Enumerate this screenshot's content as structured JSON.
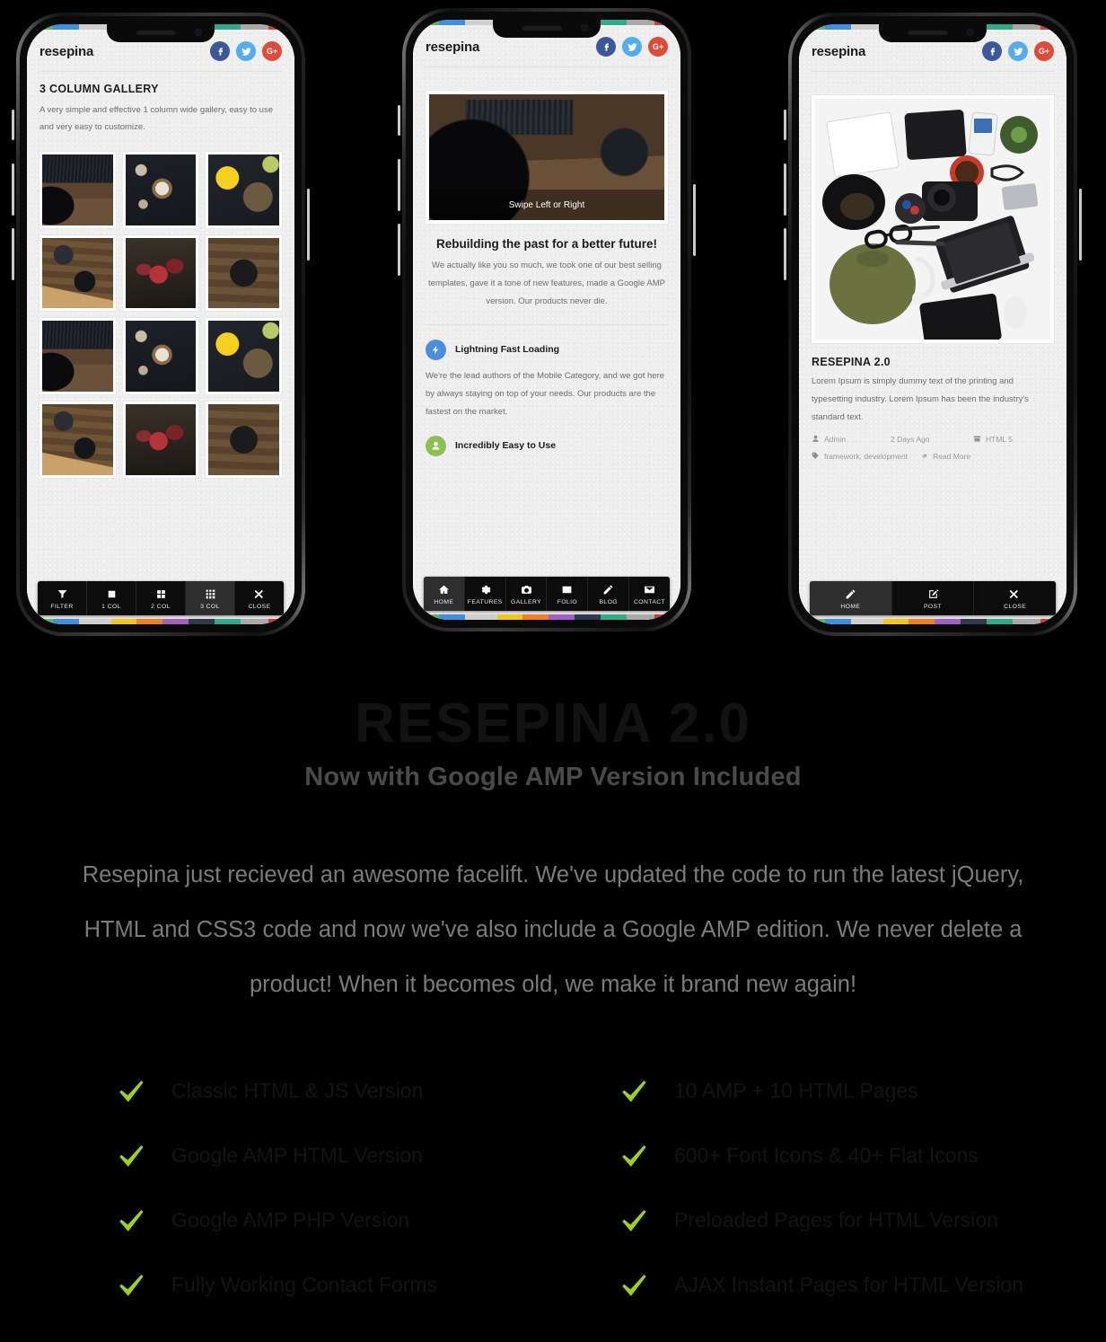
{
  "colors": {
    "facebook": "#3b5998",
    "twitter": "#55acee",
    "googleplus": "#dd4b39",
    "accent_blue": "#4b8ede",
    "accent_green": "#8cc152",
    "check_green": "#9fcf20",
    "nav_active": "#2e2e2e",
    "page_bg": "#000000",
    "screen_bg": "#eeeeee"
  },
  "rainbow": [
    "#5cb85c",
    "#3f8fe0",
    "#cfcfcf",
    "#f5c518",
    "#ef8022",
    "#a45fc4",
    "#2f3b4c",
    "#2fab8a",
    "#a9a9a9",
    "#d9392b"
  ],
  "phone1": {
    "brand": "resepina",
    "socials": [
      {
        "name": "facebook-icon",
        "label": "f"
      },
      {
        "name": "twitter-icon",
        "label": "t"
      },
      {
        "name": "google-plus-icon",
        "label": "G+"
      }
    ],
    "section_title": "3 COLUMN GALLERY",
    "section_desc": "A very simple and effective 1 column wide gallery, easy to use and very easy to customize.",
    "gallery_tiles": [
      "ph-typewriter",
      "ph-bowl",
      "ph-yellow",
      "ph-desk",
      "ph-straw",
      "ph-camera",
      "ph-typewriter",
      "ph-bowl",
      "ph-yellow",
      "ph-desk",
      "ph-straw",
      "ph-camera"
    ],
    "nav": [
      {
        "label": "FILTER",
        "icon": "filter-icon",
        "active": false
      },
      {
        "label": "1 COL",
        "icon": "square-icon",
        "active": false
      },
      {
        "label": "2 COL",
        "icon": "grid-2x2-icon",
        "active": false
      },
      {
        "label": "3 COL",
        "icon": "grid-3x3-icon",
        "active": true
      },
      {
        "label": "CLOSE",
        "icon": "close-icon",
        "active": false
      }
    ]
  },
  "phone2": {
    "brand": "resepina",
    "hero_caption": "Swipe Left or Right",
    "hero_title": "Rebuilding the past for a better future!",
    "hero_text": "We actually like you so much, we took one of our best selling templates, gave it a tone of new features, made a Google AMP version. Our products never die.",
    "features": [
      {
        "title": "Lightning Fast Loading",
        "icon": "bolt-icon",
        "color": "#4b8ede",
        "text": "We're the lead authors of the Mobile Category, and we got here by always staying on top of your needs. Our products are the fastest on the market."
      },
      {
        "title": "Incredibly Easy to Use",
        "icon": "user-icon",
        "color": "#8cc152",
        "text": ""
      }
    ],
    "nav": [
      {
        "label": "HOME",
        "icon": "home-icon",
        "active": true
      },
      {
        "label": "FEATURES",
        "icon": "gear-icon",
        "active": false
      },
      {
        "label": "GALLERY",
        "icon": "camera-icon",
        "active": false
      },
      {
        "label": "FOLIO",
        "icon": "image-icon",
        "active": false
      },
      {
        "label": "BLOG",
        "icon": "pencil-icon",
        "active": false
      },
      {
        "label": "CONTACT",
        "icon": "envelope-icon",
        "active": false
      }
    ]
  },
  "phone3": {
    "brand": "resepina",
    "post_title": "RESEPINA 2.0",
    "post_text": "Lorem Ipsum is simply dummy text of the printing and typesetting industry. Lorem Ipsum has been the industry's standard text.",
    "meta": {
      "author": "Admin",
      "date": "2 Days Ago",
      "category": "HTML 5",
      "tags": "framework, development",
      "read_more": "Read More"
    },
    "nav": [
      {
        "label": "HOME",
        "icon": "pencil-icon",
        "active": true
      },
      {
        "label": "POST",
        "icon": "edit-square-icon",
        "active": false
      },
      {
        "label": "CLOSE",
        "icon": "close-icon",
        "active": false
      }
    ]
  },
  "headline": {
    "title": "RESEPINA 2.0",
    "subtitle": "Now with Google AMP Version Included"
  },
  "lede": "Resepina just recieved an awesome facelift. We've updated the code to run the latest jQuery, HTML and CSS3 code and now we've also include a Google AMP edition. We never delete a product! When it becomes old, we make it brand new again!",
  "features_list": [
    "Classic HTML & JS Version",
    "10 AMP + 10 HTML Pages",
    "Google AMP HTML Version",
    "600+ Font Icons & 40+ Flat Icons",
    "Google AMP PHP Version",
    "Preloaded Pages for HTML Version",
    "Fully Working Contact Forms",
    "AJAX Instant Pages for HTML Version"
  ]
}
